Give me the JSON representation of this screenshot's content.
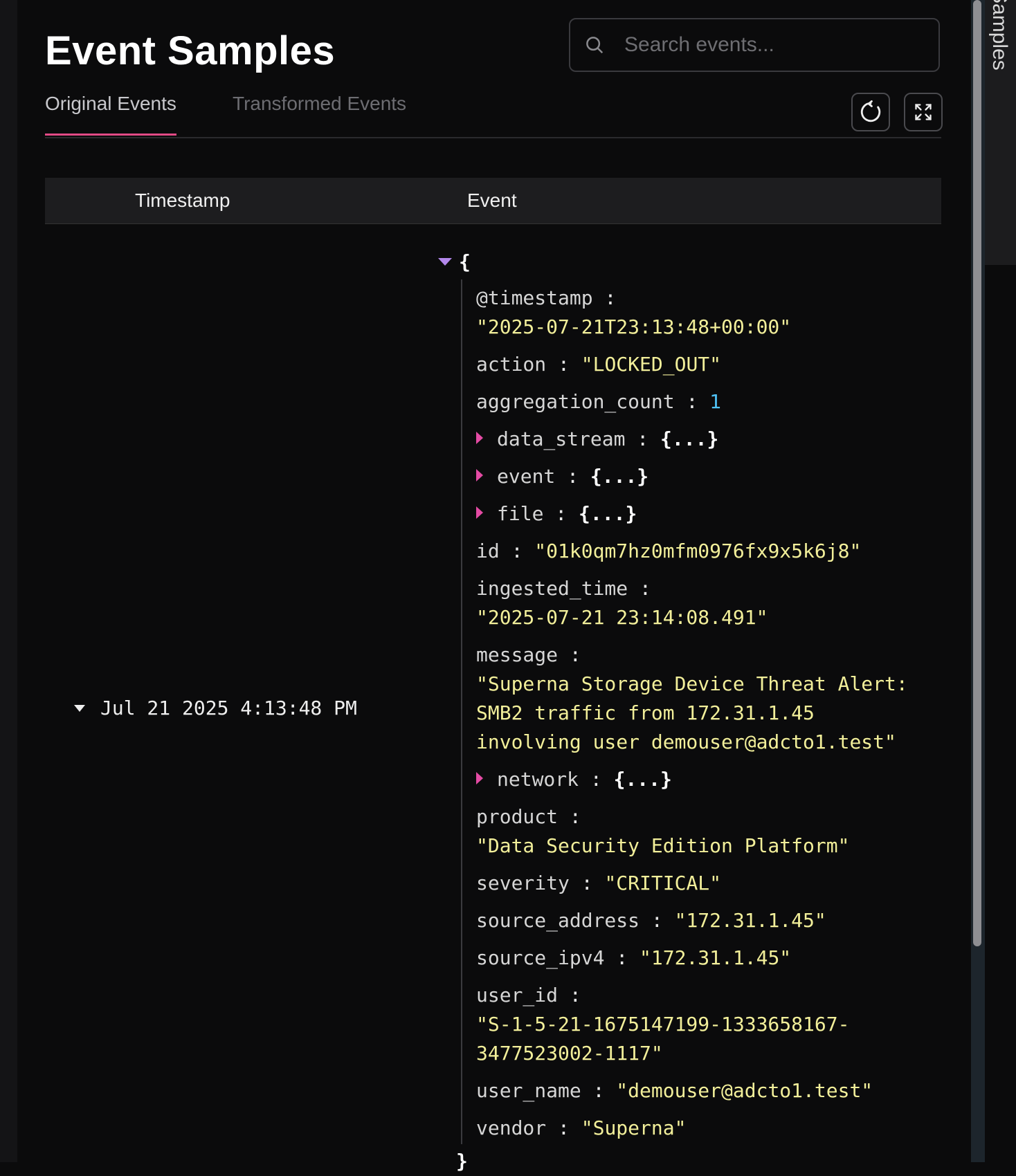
{
  "page_title": "Event Samples",
  "search": {
    "placeholder": "Search events..."
  },
  "tabs": [
    {
      "label": "Original Events",
      "active": true
    },
    {
      "label": "Transformed Events",
      "active": false
    }
  ],
  "toolbar": {
    "refresh_icon": "refresh-icon",
    "expand_icon": "expand-icon"
  },
  "table": {
    "columns": [
      "Timestamp",
      "Event"
    ],
    "row": {
      "timestamp": "Jul 21 2025 4:13:48 PM",
      "open_brace": "{",
      "close_brace": "}",
      "fields": {
        "timestamp_key": "@timestamp",
        "timestamp_val": "\"2025-07-21T23:13:48+00:00\"",
        "action_key": "action",
        "action_val": "\"LOCKED_OUT\"",
        "aggregation_key": "aggregation_count",
        "aggregation_val": "1",
        "data_stream_key": "data_stream",
        "event_key": "event",
        "file_key": "file",
        "id_key": "id",
        "id_val": "\"01k0qm7hz0mfm0976fx9x5k6j8\"",
        "ingested_key": "ingested_time",
        "ingested_val": "\"2025-07-21 23:14:08.491\"",
        "message_key": "message",
        "message_line1": "\"Superna Storage Device Threat Alert:",
        "message_line2": "SMB2 traffic from 172.31.1.45",
        "message_line3": "involving user demouser@adcto1.test\"",
        "network_key": "network",
        "product_key": "product",
        "product_val": "\"Data Security Edition Platform\"",
        "severity_key": "severity",
        "severity_val": "\"CRITICAL\"",
        "source_address_key": "source_address",
        "source_address_val": "\"172.31.1.45\"",
        "source_ipv4_key": "source_ipv4",
        "source_ipv4_val": "\"172.31.1.45\"",
        "user_id_key": "user_id",
        "user_id_line1": "\"S-1-5-21-1675147199-1333658167-",
        "user_id_line2": "3477523002-1117\"",
        "user_name_key": "user_name",
        "user_name_val": "\"demouser@adcto1.test\"",
        "vendor_key": "vendor",
        "vendor_val": "\"Superna\"",
        "collapsed_obj": "{...}",
        "colon": ":"
      }
    }
  },
  "side_panel": {
    "label": "Event Samples"
  },
  "colors": {
    "accent": "#e24b86",
    "string": "#f2ef9a",
    "number": "#4fc3f7",
    "caret": "#e44ba4"
  }
}
